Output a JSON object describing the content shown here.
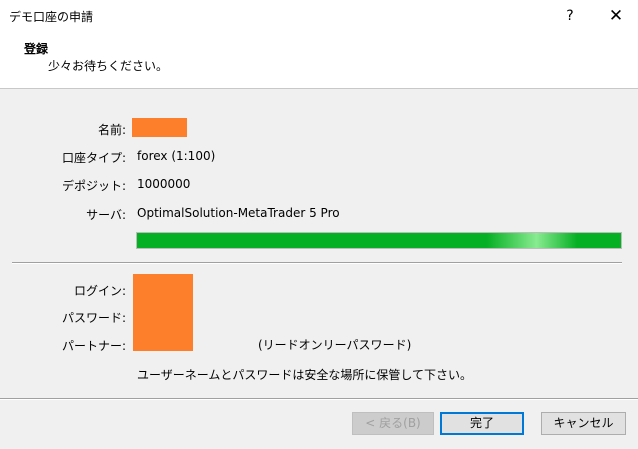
{
  "window": {
    "title": "デモ口座の申請",
    "help_glyph": "?",
    "close_glyph": "✕"
  },
  "header": {
    "title": "登録",
    "subtitle": "少々お待ちください。"
  },
  "fields": {
    "name_label": "名前:",
    "account_type_label": "口座タイプ:",
    "account_type_value": "forex (1:100)",
    "deposit_label": "デポジット:",
    "deposit_value": "1000000",
    "server_label": "サーバ:",
    "server_value": "OptimalSolution-MetaTrader 5 Pro"
  },
  "progress": {
    "fraction": 0.91
  },
  "credentials": {
    "login_label": "ログイン:",
    "password_label": "パスワード:",
    "partner_label": "パートナー:",
    "read_only_note": "(リードオンリーパスワード)",
    "save_notice": "ユーザーネームとパスワードは安全な場所に保管して下さい。"
  },
  "buttons": {
    "back": "< 戻る(B)",
    "finish": "完了",
    "cancel": "キャンセル"
  },
  "colors": {
    "redaction": "#fd7f2c",
    "progress": "#06b025",
    "focus": "#0078d7"
  }
}
